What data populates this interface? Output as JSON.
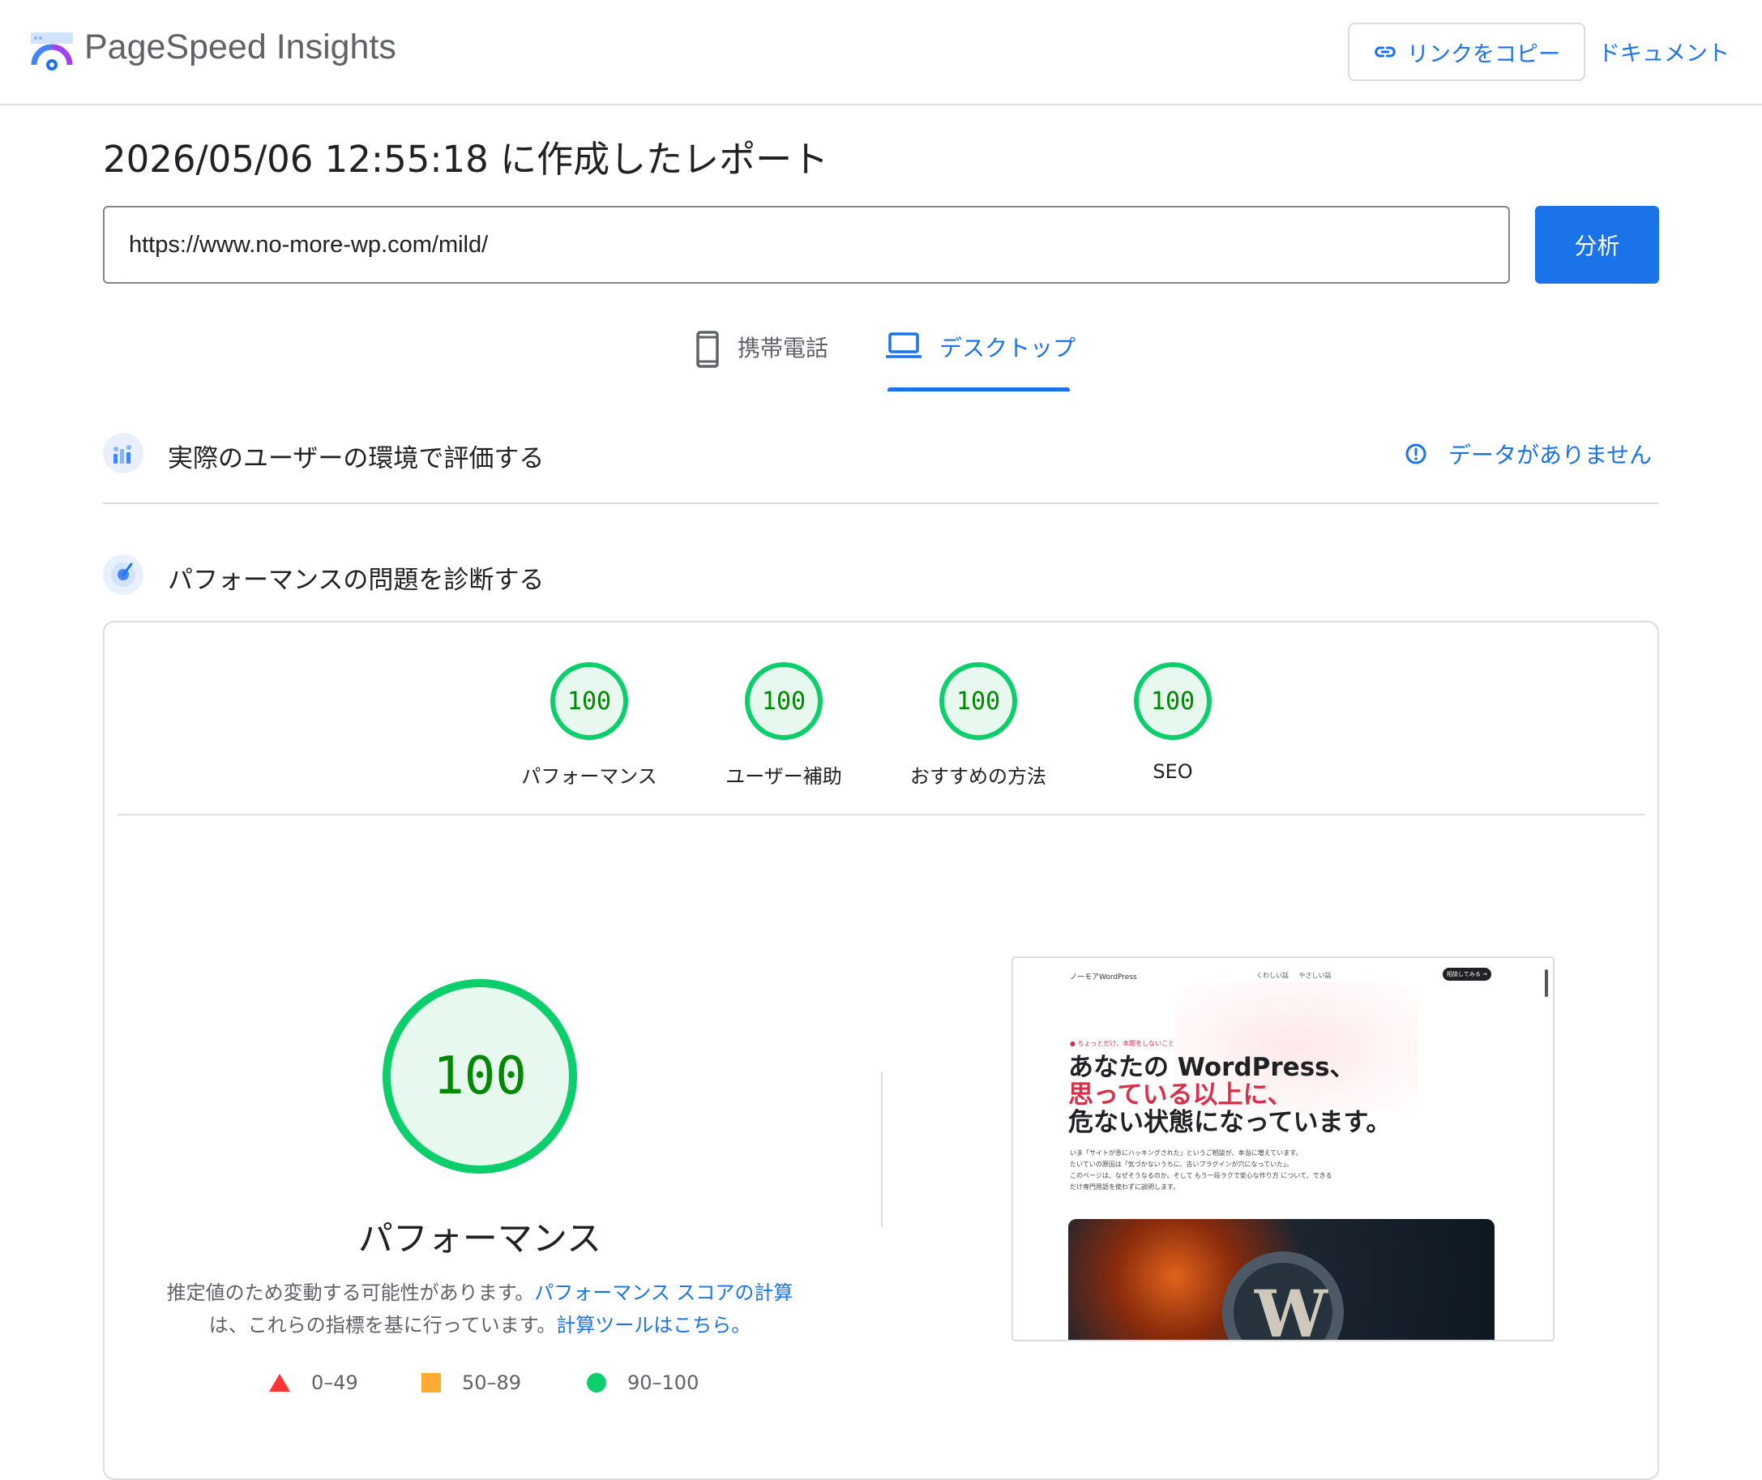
{
  "header": {
    "app_title": "PageSpeed Insights",
    "copy_link_label": "リンクをコピー",
    "docs_label": "ドキュメント"
  },
  "report": {
    "title": "2026/05/06 12:55:18 に作成したレポート",
    "url": "https://www.no-more-wp.com/mild/",
    "analyze_label": "分析"
  },
  "tabs": [
    {
      "label": "携帯電話",
      "icon": "smartphone-icon",
      "selected": false
    },
    {
      "label": "デスクトップ",
      "icon": "laptop-icon",
      "selected": true
    }
  ],
  "field_data": {
    "title": "実際のユーザーの環境で評価する",
    "status": "データがありません",
    "status_icon": "info-icon"
  },
  "diagnostics": {
    "title": "パフォーマンスの問題を診断する"
  },
  "scores": [
    {
      "value": "100",
      "label": "パフォーマンス"
    },
    {
      "value": "100",
      "label": "ユーザー補助"
    },
    {
      "value": "100",
      "label": "おすすめの方法"
    },
    {
      "value": "100",
      "label": "SEO"
    }
  ],
  "performance": {
    "score": "100",
    "title": "パフォーマンス",
    "desc_part1": "推定値のため変動する可能性があります。",
    "desc_link1": "パフォーマンス スコアの計算",
    "desc_part2": "は、これらの指標を基に行っています。",
    "desc_link2": "計算ツールはこちら。"
  },
  "legend": [
    {
      "range": "0–49",
      "shape": "triangle",
      "color": "#ff3333"
    },
    {
      "range": "50–89",
      "shape": "square",
      "color": "#ffaa33"
    },
    {
      "range": "90–100",
      "shape": "circle",
      "color": "#0cce6b"
    }
  ],
  "thumbnail": {
    "site_name": "ノーモアWordPress",
    "nav_links": "くわしい話 やさしい話",
    "cta": "相談してみる →",
    "kicker": "● ちょっとだけ、本題をしないこと",
    "headline_1": "あなたの WordPress、",
    "headline_2": "思っている以上に、",
    "headline_3": "危ない状態になっています。",
    "body_1": "いま「サイトが急にハッキングされた」というご相談が、本当に増えています。",
    "body_2": "たいていの原因は「気づかないうちに、古いプラグインが穴になっていた」。",
    "body_3": "このページは、なぜそうなるのか、そして もう一段ラクで安心な作り方 について、できる",
    "body_4": "だけ専門用語を使わずに説明します。"
  },
  "colors": {
    "accent": "#1a73e8",
    "pass": "#0cce6b",
    "pass_text": "#008800",
    "pass_bg": "#e7f9ef"
  }
}
